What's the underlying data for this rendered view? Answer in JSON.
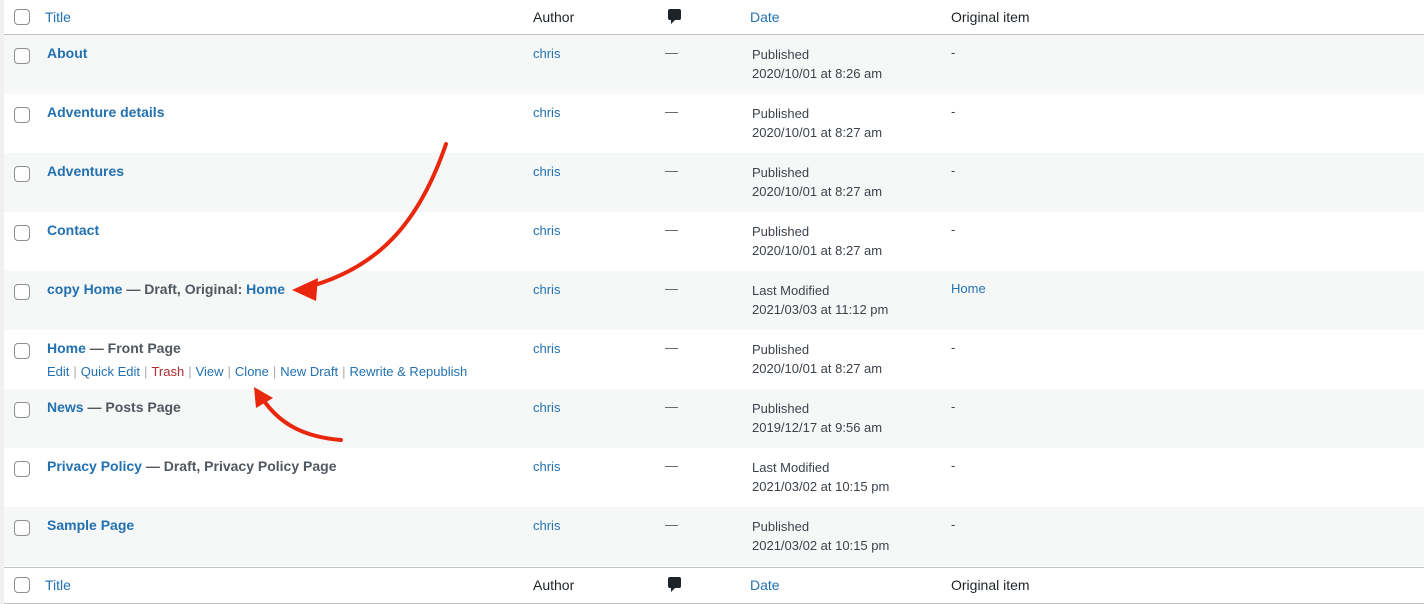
{
  "columns": {
    "title": "Title",
    "author": "Author",
    "comments_icon": "comment-icon",
    "date": "Date",
    "original": "Original item"
  },
  "rows": [
    {
      "title": "About",
      "state": "",
      "state_link": "",
      "author": "chris",
      "comments": "—",
      "status": "Published",
      "datetime": "2020/10/01 at 8:26 am",
      "original": "-"
    },
    {
      "title": "Adventure details",
      "state": "",
      "state_link": "",
      "author": "chris",
      "comments": "—",
      "status": "Published",
      "datetime": "2020/10/01 at 8:27 am",
      "original": "-"
    },
    {
      "title": "Adventures",
      "state": "",
      "state_link": "",
      "author": "chris",
      "comments": "—",
      "status": "Published",
      "datetime": "2020/10/01 at 8:27 am",
      "original": "-"
    },
    {
      "title": "Contact",
      "state": "",
      "state_link": "",
      "author": "chris",
      "comments": "—",
      "status": "Published",
      "datetime": "2020/10/01 at 8:27 am",
      "original": "-"
    },
    {
      "title": "copy Home",
      "state": " — Draft, Original: ",
      "state_link": "Home",
      "author": "chris",
      "comments": "—",
      "status": "Last Modified",
      "datetime": "2021/03/03 at 11:12 pm",
      "original": "Home"
    },
    {
      "title": "Home",
      "state": " — Front Page",
      "state_link": "",
      "author": "chris",
      "comments": "—",
      "status": "Published",
      "datetime": "2020/10/01 at 8:27 am",
      "original": "-"
    },
    {
      "title": "News",
      "state": " — Posts Page",
      "state_link": "",
      "author": "chris",
      "comments": "—",
      "status": "Published",
      "datetime": "2019/12/17 at 9:56 am",
      "original": "-"
    },
    {
      "title": "Privacy Policy",
      "state": " — Draft, Privacy Policy Page",
      "state_link": "",
      "author": "chris",
      "comments": "—",
      "status": "Last Modified",
      "datetime": "2021/03/02 at 10:15 pm",
      "original": "-"
    },
    {
      "title": "Sample Page",
      "state": "",
      "state_link": "",
      "author": "chris",
      "comments": "—",
      "status": "Published",
      "datetime": "2021/03/02 at 10:15 pm",
      "original": "-"
    }
  ],
  "row_actions": {
    "edit": "Edit",
    "quick_edit": "Quick Edit",
    "trash": "Trash",
    "view": "View",
    "clone": "Clone",
    "new_draft": "New Draft",
    "rewrite_republish": "Rewrite & Republish"
  },
  "colors": {
    "link": "#2271b1",
    "trash": "#b32d2e",
    "annotation_arrow": "#e8270d"
  }
}
